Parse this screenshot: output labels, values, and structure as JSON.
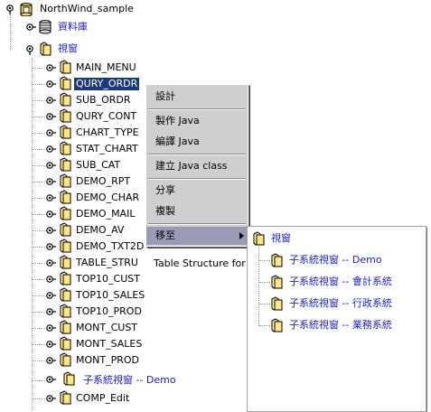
{
  "tree": {
    "root": {
      "label": "NorthWind_sample"
    },
    "database": {
      "label": "資料庫"
    },
    "views": {
      "label": "視窗"
    },
    "items": [
      "MAIN_MENU",
      "QURY_ORDR",
      "SUB_ORDR",
      "QURY_CONT",
      "CHART_TYPE",
      "STAT_CHART",
      "SUB_CAT",
      "DEMO_RPT",
      "DEMO_CHAR",
      "DEMO_MAIL",
      "DEMO_AV",
      "DEMO_TXT2D",
      "TABLE_STRU",
      "TOP10_CUST",
      "TOP10_SALES",
      "TOP10_PROD",
      "MONT_CUST",
      "MONT_SALES",
      "MONT_PROD"
    ],
    "subsystem_item": "子系統視窗 -- Demo",
    "last_item": "COMP_Edit",
    "tooltip": "Table Structure for"
  },
  "context_menu": {
    "design": "設計",
    "make_java": "製作 Java",
    "compile_java": "編譯 Java",
    "build_class": "建立 Java class",
    "share": "分享",
    "copy": "複製",
    "move_to": "移至"
  },
  "submenu": {
    "root": "視窗",
    "items": [
      "子系統視窗 -- Demo",
      "子系統視窗 -- 會計系統",
      "子系統視窗 -- 行政系統",
      "子系統視窗 -- 業務系統"
    ]
  },
  "colors": {
    "selection": "#1a3a7a",
    "menu_highlight": "#9a9ab7",
    "link_blue": "#1b1bd6"
  }
}
